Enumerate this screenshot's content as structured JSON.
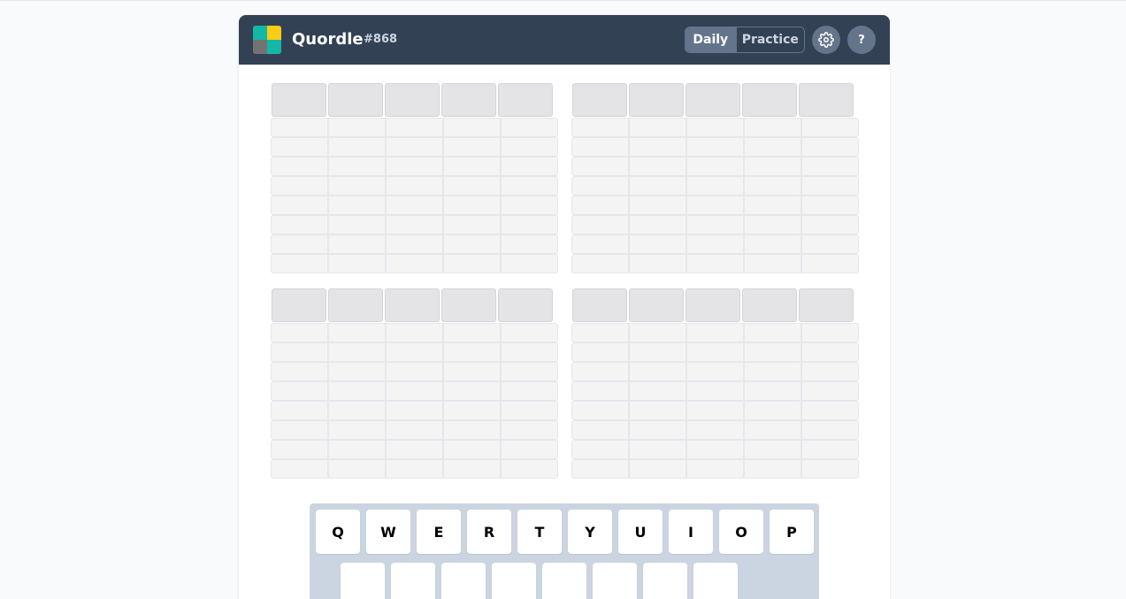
{
  "header": {
    "title": "Quordle",
    "game_number": "#868",
    "logo_colors": [
      "#14b8a6",
      "#facc15",
      "#737373",
      "#14b8a6"
    ],
    "modes": {
      "daily": "Daily",
      "practice": "Practice",
      "selected": "Daily"
    },
    "settings_icon": "gear-icon",
    "help_label": "?"
  },
  "boards": {
    "count": 4,
    "rows_per_board": 9,
    "letters_per_row": 5
  },
  "keyboard": {
    "row1": [
      "Q",
      "W",
      "E",
      "R",
      "T",
      "Y",
      "U",
      "I",
      "O",
      "P"
    ],
    "row2_visible_keys": 8
  },
  "colors": {
    "header_bg": "#334155",
    "accent": "#64748b",
    "keyboard_bg": "#cbd5e1"
  }
}
